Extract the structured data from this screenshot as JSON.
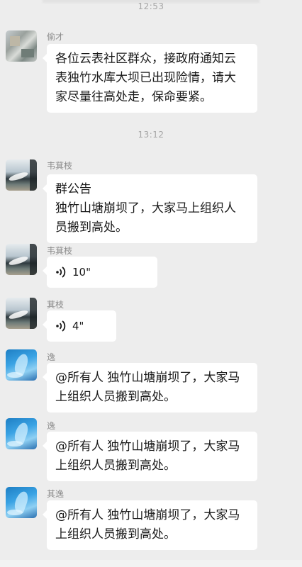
{
  "timestamps": {
    "first": "12:53",
    "second": "13:12"
  },
  "messages": [
    {
      "sender": "偷才",
      "avatar": "gray-photo-avatar",
      "text": "各位云表社区群众，接政府通知云\n表独竹水库大坝已出现险情，请大\n家尽量往高处走，保命要紧。"
    },
    {
      "sender": "韦萁枝",
      "avatar": "wave-photo-avatar",
      "text": "群公告\n独竹山塘崩坝了，大家马上组织人\n员搬到高处。"
    },
    {
      "sender": "韦萁枝",
      "avatar": "wave-photo-avatar",
      "type": "voice",
      "duration": "10\""
    },
    {
      "sender": "萁枝",
      "avatar": "wave-photo-avatar",
      "type": "voice",
      "duration": "4\""
    },
    {
      "sender": "逸",
      "avatar": "blue-art-avatar",
      "text": "@所有人 独竹山塘崩坝了，大家马\n上组织人员搬到高处。"
    },
    {
      "sender": "逸",
      "avatar": "blue-art-avatar",
      "text": "@所有人 独竹山塘崩坝了，大家马\n上组织人员搬到高处。"
    },
    {
      "sender": "其逸",
      "avatar": "blue-art-avatar",
      "text": "@所有人 独竹山塘崩坝了，大家马\n上组织人员搬到高处。"
    }
  ],
  "icons": {
    "voice": "voice-wave-icon"
  },
  "colors": {
    "background": "#ededed",
    "bubble": "#ffffff",
    "timestamp": "#a6a6a6",
    "name": "#8c8c8c"
  }
}
